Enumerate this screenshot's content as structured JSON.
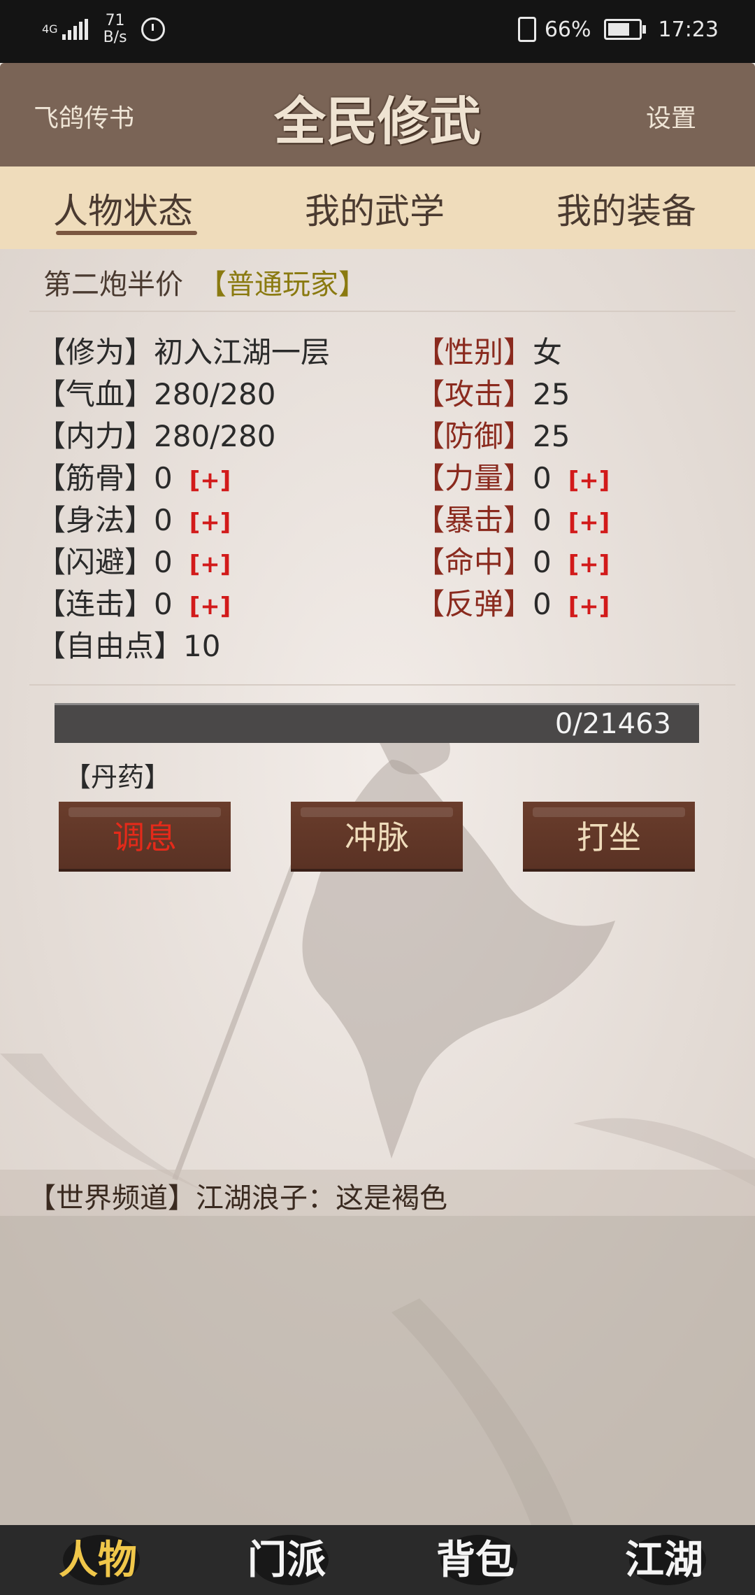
{
  "status_bar": {
    "network": "4G",
    "speed_value": "71",
    "speed_unit": "B/s",
    "battery": "66%",
    "time": "17:23"
  },
  "header": {
    "left_label": "飞鸽传书",
    "title": "全民修武",
    "right_label": "设置"
  },
  "tabs": [
    {
      "label": "人物状态"
    },
    {
      "label": "我的武学"
    },
    {
      "label": "我的装备"
    }
  ],
  "player": {
    "name": "第二炮半价",
    "tag": "【普通玩家】"
  },
  "stats_left": [
    {
      "key": "【修为】",
      "value": "初入江湖一层"
    },
    {
      "key": "【气血】",
      "value": "280/280"
    },
    {
      "key": "【内力】",
      "value": "280/280"
    },
    {
      "key": "【筋骨】",
      "value": "0",
      "plus": "[+]"
    },
    {
      "key": "【身法】",
      "value": "0",
      "plus": "[+]"
    },
    {
      "key": "【闪避】",
      "value": "0",
      "plus": "[+]"
    },
    {
      "key": "【连击】",
      "value": "0",
      "plus": "[+]"
    },
    {
      "key": "【自由点】",
      "value": "10"
    }
  ],
  "stats_right": [
    {
      "key": "【性别】",
      "value": "女"
    },
    {
      "key": "【攻击】",
      "value": "25"
    },
    {
      "key": "【防御】",
      "value": "25"
    },
    {
      "key": "【力量】",
      "value": "0",
      "plus": "[+]"
    },
    {
      "key": "【暴击】",
      "value": "0",
      "plus": "[+]"
    },
    {
      "key": "【命中】",
      "value": "0",
      "plus": "[+]"
    },
    {
      "key": "【反弹】",
      "value": "0",
      "plus": "[+]"
    }
  ],
  "progress": {
    "text": "0/21463",
    "fraction": 0
  },
  "elixir_label": "【丹药】",
  "actions": [
    {
      "label": "调息"
    },
    {
      "label": "冲脉"
    },
    {
      "label": "打坐"
    }
  ],
  "world_channel": {
    "text": "【世界频道】江湖浪子：这是褐色"
  },
  "bottom_nav": [
    {
      "label": "人物"
    },
    {
      "label": "门派"
    },
    {
      "label": "背包"
    },
    {
      "label": "江湖"
    }
  ]
}
